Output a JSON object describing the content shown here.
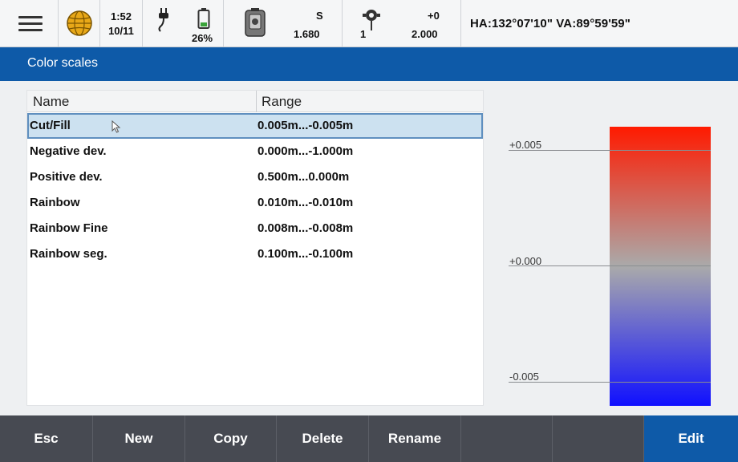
{
  "status": {
    "time": "1:52",
    "date": "10/11",
    "battery": "26%",
    "instrument_label": "S",
    "instrument_value": "1.680",
    "target_count": "1",
    "target_offset": "+0",
    "target_height": "2.000",
    "angles": "HA:132°07'10\"  VA:89°59'59\""
  },
  "title": "Color scales",
  "list": {
    "columns": [
      "Name",
      "Range"
    ],
    "rows": [
      {
        "name": "Cut/Fill",
        "range": "0.005m...-0.005m"
      },
      {
        "name": "Negative dev.",
        "range": "0.000m...-1.000m"
      },
      {
        "name": "Positive dev.",
        "range": "0.500m...0.000m"
      },
      {
        "name": "Rainbow",
        "range": "0.010m...-0.010m"
      },
      {
        "name": "Rainbow Fine",
        "range": "0.008m...-0.008m"
      },
      {
        "name": "Rainbow seg.",
        "range": "0.100m...-0.100m"
      }
    ],
    "selected_index": 0
  },
  "scale": {
    "labels": [
      "+0.005",
      "+0.000",
      "-0.005"
    ],
    "colors": {
      "top": "#ff1a00",
      "middle": "#aaaaaa",
      "bottom": "#1010ff"
    }
  },
  "toolbar": {
    "buttons": [
      "Esc",
      "New",
      "Copy",
      "Delete",
      "Rename",
      "",
      "",
      "Edit"
    ]
  },
  "colors": {
    "accent": "#0e5aa8",
    "toolbar": "#474a52",
    "selection": "#cce1f0"
  }
}
